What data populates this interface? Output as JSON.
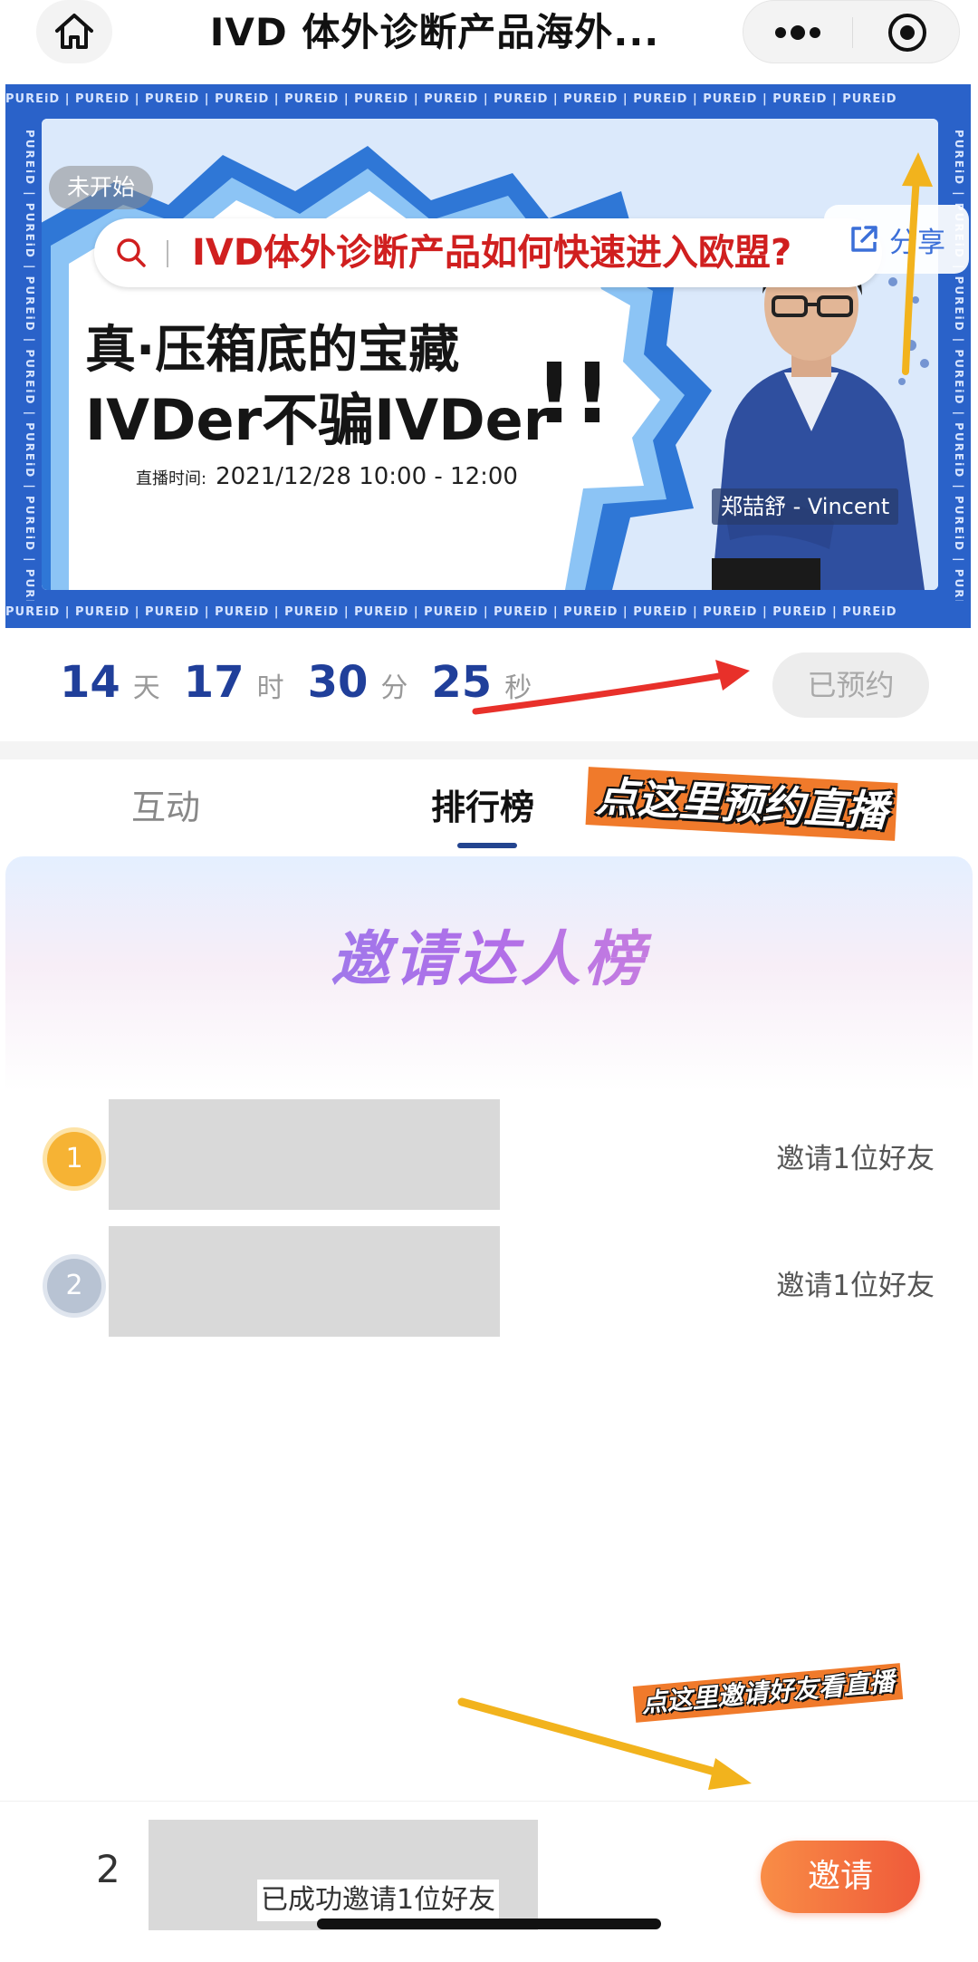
{
  "nav": {
    "title": "IVD 体外诊断产品海外...",
    "home_icon": "home-icon",
    "more_icon": "more-dots-icon",
    "target_icon": "record-target-icon"
  },
  "banner": {
    "brand_strip": "PUREiD | PUREiD | PUREiD | PUREiD | PUREiD | PUREiD | PUREiD | PUREiD | PUREiD | PUREiD | PUREiD | PUREiD | PUREiD",
    "status": "未开始",
    "search_query": "IVD体外诊断产品如何快速进入欧盟?",
    "share_label": "分享",
    "headline_line1": "真·压箱底的宝藏",
    "headline_line2": "IVDer不骗IVDer",
    "headline_marks": "!!",
    "airtime_label": "直播时间:",
    "airtime_value": "2021/12/28  10:00 - 12:00",
    "speaker_name": "郑喆舒 - Vincent",
    "colors": {
      "frame": "#2a62c9",
      "query": "#d01f1f",
      "share": "#3b6fd8"
    }
  },
  "countdown": {
    "days": "14",
    "days_unit": "天",
    "hours": "17",
    "hours_unit": "时",
    "minutes": "30",
    "minutes_unit": "分",
    "seconds": "25",
    "seconds_unit": "秒",
    "reserved_label": "已预约"
  },
  "tabs": [
    {
      "label": "互动",
      "active": false
    },
    {
      "label": "排行榜",
      "active": true
    }
  ],
  "leaderboard": {
    "title": "邀请达人榜",
    "rows": [
      {
        "rank": "1",
        "text": "邀请1位好友"
      },
      {
        "rank": "2",
        "text": "邀请1位好友"
      }
    ]
  },
  "bottom": {
    "my_rank": "2",
    "my_status": "已成功邀请1位好友",
    "invite_label": "邀请"
  },
  "annotations": {
    "reserve_hint": "点这里预约直播",
    "invite_hint": "点这里邀请好友看直播"
  }
}
